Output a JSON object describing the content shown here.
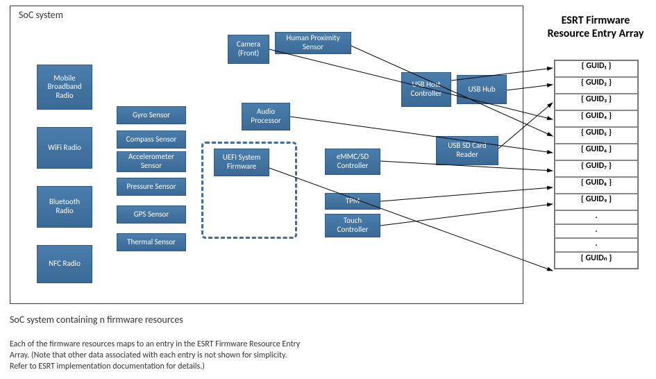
{
  "soc_title": "SoC system",
  "esrt_title_line1": "ESRT Firmware",
  "esrt_title_line2": "Resource Entry Array",
  "nodes": {
    "mobile_bb": "Mobile Broadband Radio",
    "wifi": "WiFi Radio",
    "bluetooth": "Bluetooth Radio",
    "nfc": "NFC Radio",
    "gyro": "Gyro Sensor",
    "compass": "Compass Sensor",
    "accel": "Accelerometer Sensor",
    "pressure": "Pressure Sensor",
    "gps": "GPS Sensor",
    "thermal": "Thermal Sensor",
    "camera": "Camera (Front)",
    "proximity": "Human Proximity Sensor",
    "audio": "Audio Processor",
    "uefi": "UEFI System Firmware",
    "emmc": "eMMC/SD Controller",
    "tpm": "TPM",
    "touch": "Touch Controller",
    "usb_host": "USB Host Controller",
    "usb_hub": "USB Hub",
    "usb_sd": "USB SD Card Reader"
  },
  "guids": [
    "{ GUID₁ }",
    "{ GUID₂ }",
    "{ GUID₃ }",
    "{ GUID₄ }",
    "{ GUID₅ }",
    "{ GUID₆ }",
    "{ GUID₇ }",
    "{ GUID₈ }",
    "{ GUID₉ }"
  ],
  "guid_last": "{ GUIDₙ }",
  "caption_main": "SoC system containing n firmware resources",
  "caption_sub": "Each of the firmware resources maps to an entry in the ESRT Firmware Resource Entry\nArray. (Note that other data associated with each entry is not shown for simplicity.\nRefer to ESRT implementation documentation for details.)"
}
